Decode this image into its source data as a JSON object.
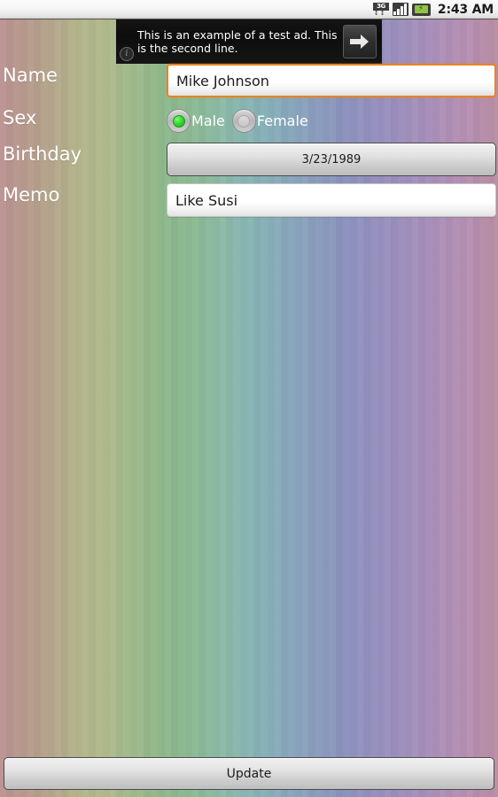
{
  "status_bar": {
    "network_label": "3G",
    "time": "2:43 AM",
    "icons": {
      "network": "3g-icon",
      "signal": "signal-bars-icon",
      "battery": "battery-charging-icon"
    }
  },
  "ad_banner": {
    "text": "This is an example of a test ad. This is the second line.",
    "info_glyph": "i",
    "arrow_glyph": "→"
  },
  "form": {
    "rows": [
      {
        "label": "Name",
        "value": "Mike Johnson"
      },
      {
        "label": "Sex",
        "value": ""
      },
      {
        "label": "Birthday",
        "value": "3/23/1989"
      },
      {
        "label": "Memo",
        "value": "Like Susi"
      }
    ],
    "name": {
      "label": "Name",
      "value": "Mike Johnson",
      "placeholder": "Name",
      "focused": true,
      "focus_color": "#e88425"
    },
    "sex": {
      "label": "Sex",
      "selected": "Male",
      "options": [
        {
          "label": "Male",
          "checked": true
        },
        {
          "label": "Female",
          "checked": false
        }
      ],
      "checked_color": "#2ad42a"
    },
    "birthday": {
      "label": "Birthday",
      "value": "3/23/1989"
    },
    "memo": {
      "label": "Memo",
      "value": "Like Susi",
      "placeholder": "Memo",
      "focused": false
    }
  },
  "footer": {
    "update_label": "Update"
  },
  "theme": {
    "background_start": "#bb9292",
    "background_mid": "#8bb98b",
    "background_end": "#b98da4",
    "label_color": "#ffffff",
    "accent_focus": "#e88425",
    "radio_on": "#2ad42a",
    "battery_green": "#8ec63f"
  }
}
